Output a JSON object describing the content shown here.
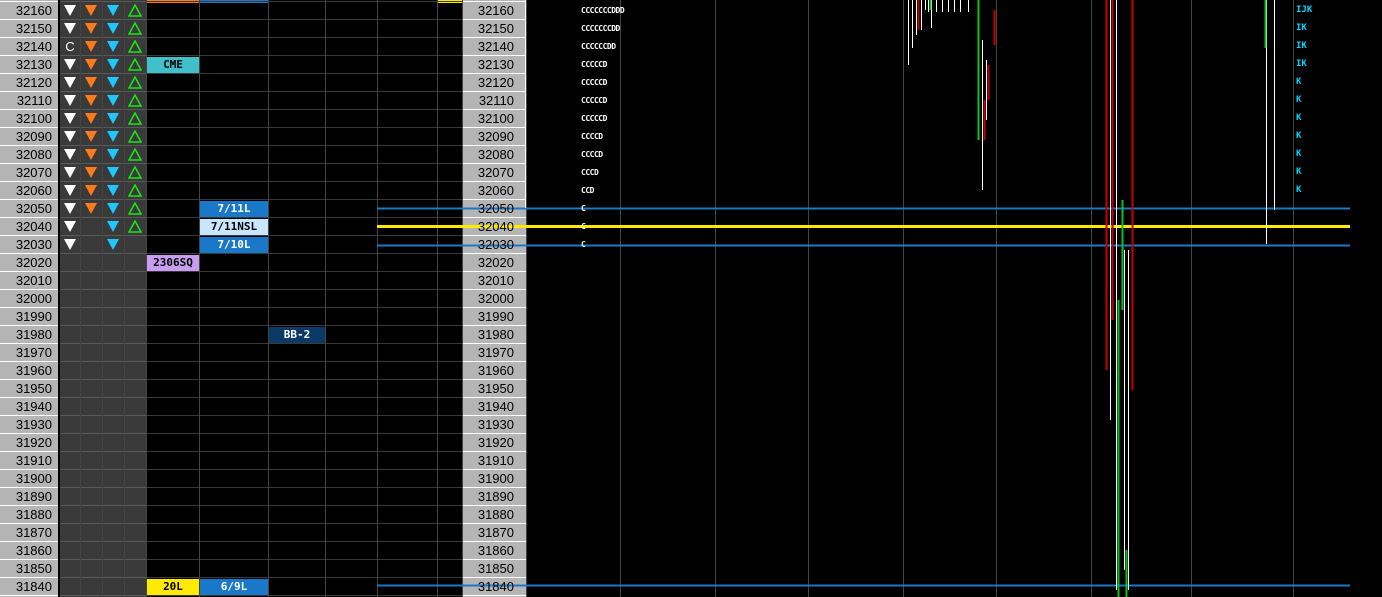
{
  "prices": [
    "32160",
    "32150",
    "32140",
    "32130",
    "32120",
    "32110",
    "32100",
    "32090",
    "32080",
    "32070",
    "32060",
    "32050",
    "32040",
    "32030",
    "32020",
    "32010",
    "32000",
    "31990",
    "31980",
    "31970",
    "31960",
    "31950",
    "31940",
    "31930",
    "31920",
    "31910",
    "31900",
    "31890",
    "31880",
    "31870",
    "31860",
    "31850",
    "31840"
  ],
  "order_rows": 14,
  "marker_c": "C",
  "tags": {
    "cme": "CME",
    "sq": "2306SQ",
    "l711": "7/11L",
    "nsl711": "7/11NSL",
    "l710": "7/10L",
    "bb2": "BB-2",
    "l20": "20L",
    "l69": "6/9L"
  },
  "tpo_left": [
    "CCCCCCCDDD",
    "CCCCCCCDD",
    "CCCCCCDD",
    "CCCCCD",
    "CCCCCD",
    "CCCCCD",
    "CCCCCD",
    "CCCCD",
    "CCCCD",
    "CCCD",
    "CCD",
    "C",
    "C",
    "C"
  ],
  "tpo_right": [
    "IJK",
    "IK",
    "IK",
    "IK",
    "K",
    "K",
    "K",
    "K",
    "K",
    "K",
    "K"
  ],
  "colors": {
    "price_bg": "#b5b5b5",
    "icon_bg": "#404040",
    "sell": "#ffffff",
    "mid": "#ff7a1a",
    "buy": "#1ec7ff",
    "buy_outline": "#19e619",
    "cme": "#40c0c8",
    "sq": "#c89cf0",
    "level": "#1a78c8",
    "nsl": "#c8e6ff",
    "bb": "#0c3a66",
    "yellow": "#ffea00",
    "hline": "#1a78c8",
    "red": "#c80000",
    "green": "#10c020"
  }
}
